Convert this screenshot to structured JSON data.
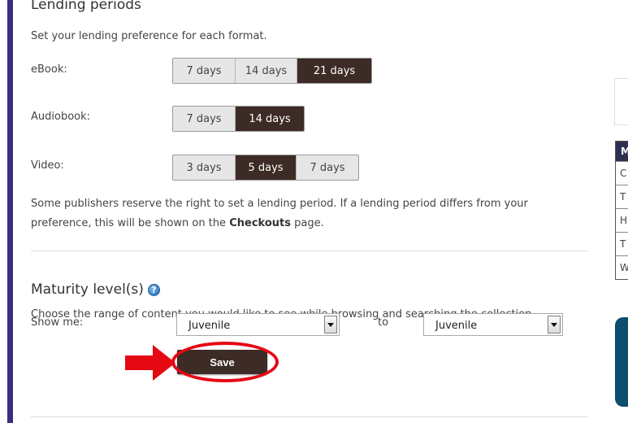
{
  "lending": {
    "title": "Lending periods",
    "description": "Set your lending preference for each format.",
    "ebook": {
      "label": "eBook:",
      "options": [
        "7 days",
        "14 days",
        "21 days"
      ],
      "selected": "21 days"
    },
    "audiobook": {
      "label": "Audiobook:",
      "options": [
        "7 days",
        "14 days"
      ],
      "selected": "14 days"
    },
    "video": {
      "label": "Video:",
      "options": [
        "3 days",
        "5 days",
        "7 days"
      ],
      "selected": "5 days"
    },
    "note_part1": "Some publishers reserve the right to set a lending period. If a lending period differs from your preference, this will be shown on the ",
    "note_link": "Checkouts",
    "note_part2": " page."
  },
  "maturity": {
    "title": "Maturity level(s)",
    "description": "Choose the range of content you would like to see while browsing and searching the collection.",
    "show_me_label": "Show me:",
    "from_value": "Juvenile",
    "to_label": "to",
    "to_value": "Juvenile",
    "save_label": "Save"
  },
  "right_panel": {
    "header_letter": "M",
    "row_letters": [
      "C",
      "T",
      "H",
      "T",
      "W"
    ]
  },
  "colors": {
    "accent_bar": "#3b2e7e",
    "selected_segment": "#3d2b26",
    "annotation": "#e50914"
  }
}
